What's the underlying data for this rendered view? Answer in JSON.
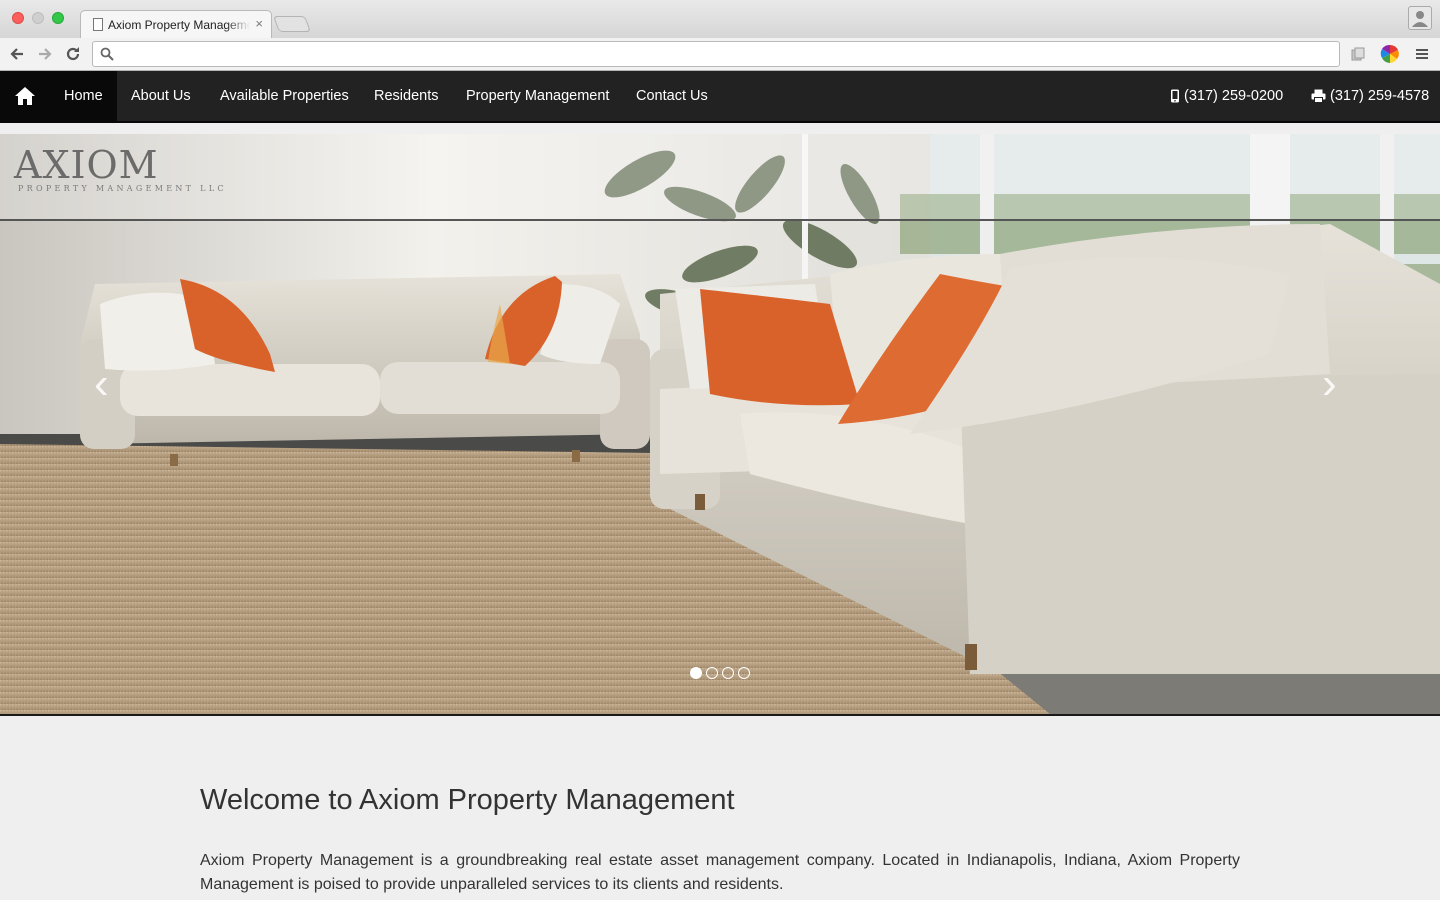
{
  "browser": {
    "tab_title": "Axiom Property Management",
    "tab_close": "×",
    "address": "",
    "icons": [
      "back-icon",
      "forward-icon",
      "reload-icon",
      "search-icon",
      "extension-icon",
      "color-wheel-icon",
      "menu-icon",
      "profile-icon",
      "page-icon"
    ]
  },
  "nav": {
    "home_icon": "home-icon",
    "items": [
      {
        "label": "Home",
        "active": true
      },
      {
        "label": "About Us"
      },
      {
        "label": "Available Properties"
      },
      {
        "label": "Residents"
      },
      {
        "label": "Property Management"
      },
      {
        "label": "Contact Us"
      }
    ],
    "phone": "(317) 259-0200",
    "phone_icon": "mobile-phone-icon",
    "fax": "(317) 259-4578",
    "fax_icon": "fax-icon"
  },
  "hero": {
    "logo_text": "AXIOM",
    "logo_subtext": "PROPERTY MANAGEMENT LLC",
    "prev_arrow": "‹",
    "next_arrow": "›",
    "slide_count": 4,
    "active_slide": 1
  },
  "content": {
    "title": "Welcome to Axiom Property Management",
    "body": "Axiom Property Management is a groundbreaking real estate asset management company. Located in Indianapolis, Indiana, Axiom Property Management is poised to provide unparalleled services to its clients and residents."
  },
  "colors": {
    "nav_bg": "#222222",
    "nav_active_bg": "#090909",
    "page_bg": "#efefef",
    "cushion": "#d9622b"
  }
}
